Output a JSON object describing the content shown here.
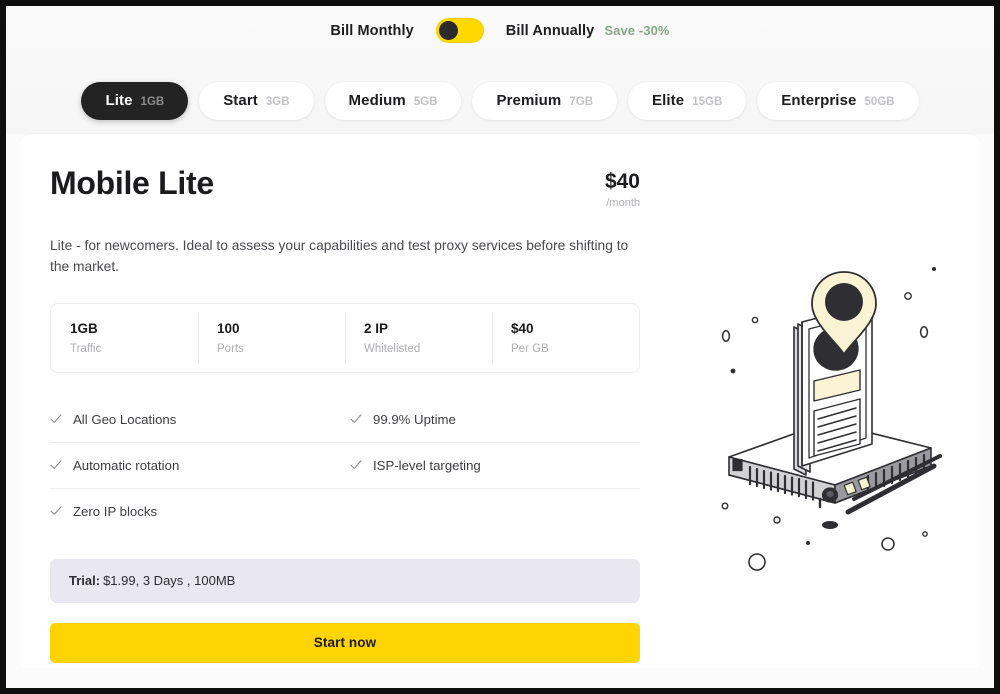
{
  "billing": {
    "monthly_label": "Bill Monthly",
    "annually_label": "Bill Annually",
    "save_badge": "Save -30%",
    "toggle_state": "monthly",
    "accent_color": "#ffd800",
    "save_color": "#83a883"
  },
  "tabs": [
    {
      "name": "Lite",
      "size": "1GB",
      "active": true
    },
    {
      "name": "Start",
      "size": "3GB",
      "active": false
    },
    {
      "name": "Medium",
      "size": "5GB",
      "active": false
    },
    {
      "name": "Premium",
      "size": "7GB",
      "active": false
    },
    {
      "name": "Elite",
      "size": "15GB",
      "active": false
    },
    {
      "name": "Enterprise",
      "size": "50GB",
      "active": false
    }
  ],
  "plan": {
    "title": "Mobile Lite",
    "price_amount": "$40",
    "price_period": "/month",
    "description": "Lite - for newcomers. Ideal to assess your capabilities and test proxy services before shifting to the market."
  },
  "specs": [
    {
      "value": "1GB",
      "label": "Traffic"
    },
    {
      "value": "100",
      "label": "Ports"
    },
    {
      "value": "2 IP",
      "label": "Whitelisted"
    },
    {
      "value": "$40",
      "label": "Per GB"
    }
  ],
  "features": [
    {
      "text": "All Geo Locations"
    },
    {
      "text": "99.9% Uptime"
    },
    {
      "text": "Automatic rotation"
    },
    {
      "text": "ISP-level targeting"
    },
    {
      "text": "Zero IP blocks"
    }
  ],
  "trial": {
    "prefix": "Trial:",
    "details": " $1.99, 3 Days , 100MB",
    "background_color": "#e9e8f0"
  },
  "cta": {
    "label": "Start now",
    "background_color": "#ffd400"
  },
  "illustration": {
    "name": "isometric-router-with-phone-and-location-pin",
    "pin_fill": "#faf3d4",
    "device_fill": "#ffffff",
    "outline_color": "#2f2f33"
  }
}
